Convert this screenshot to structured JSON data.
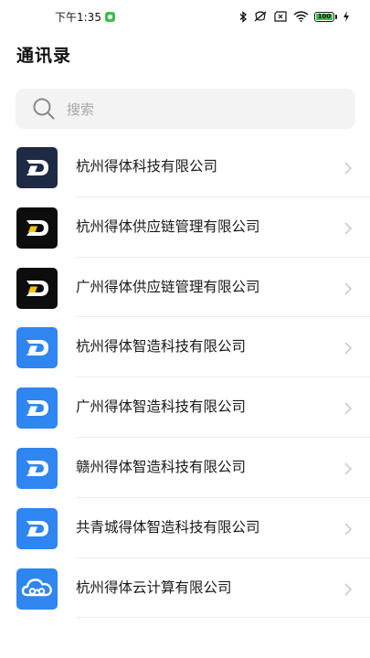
{
  "status_bar": {
    "time": "下午1:35",
    "battery": "100"
  },
  "header": {
    "title": "通讯录"
  },
  "search": {
    "placeholder": "搜索"
  },
  "colors": {
    "navy": "#1f2a44",
    "black": "#0d0d0d",
    "blue": "#2f86f0",
    "yellow": "#f5c400",
    "divider": "#ededed"
  },
  "companies": [
    {
      "name": "杭州得体科技有限公司",
      "logo": "d-logo-navy-icon"
    },
    {
      "name": "杭州得体供应链管理有限公司",
      "logo": "d-logo-black-yellow-icon"
    },
    {
      "name": "广州得体供应链管理有限公司",
      "logo": "d-logo-black-yellow-icon"
    },
    {
      "name": "杭州得体智造科技有限公司",
      "logo": "d-logo-blue-icon"
    },
    {
      "name": "广州得体智造科技有限公司",
      "logo": "d-logo-blue-icon"
    },
    {
      "name": "赣州得体智造科技有限公司",
      "logo": "d-logo-blue-icon"
    },
    {
      "name": "共青城得体智造科技有限公司",
      "logo": "d-logo-blue-icon"
    },
    {
      "name": "杭州得体云计算有限公司",
      "logo": "cloud-logo-blue-icon"
    }
  ]
}
